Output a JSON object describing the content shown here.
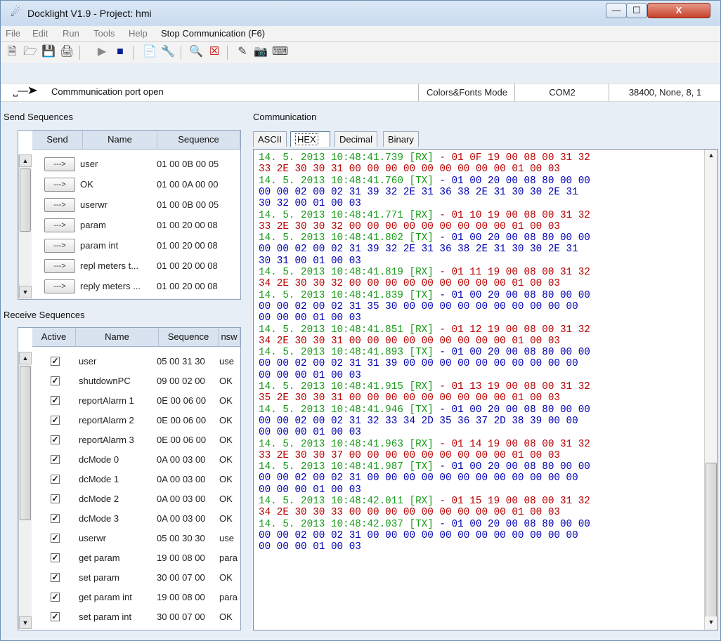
{
  "window": {
    "title": "Docklight V1.9 - Project: hmi",
    "app_icon": "docklight-app-icon",
    "buttons": {
      "minimize": "—",
      "maximize": "☐",
      "close": "X"
    }
  },
  "menu": [
    "File",
    "Edit",
    "Run",
    "Tools",
    "Help",
    "Stop Communication  (F6)"
  ],
  "toolbar": [
    "new-file-icon",
    "open-folder-icon",
    "save-icon",
    "print-icon",
    "play-icon",
    "stop-icon",
    "properties-icon",
    "wrench-icon",
    "binoculars-icon",
    "clear-icon",
    "edit-icon",
    "camera-icon",
    "keyboard-icon"
  ],
  "status": {
    "connection": "Commmunication port open",
    "colors_mode": "Colors&Fonts Mode",
    "port": "COM2",
    "settings": "38400, None, 8, 1"
  },
  "send": {
    "label": "Send Sequences",
    "headers": [
      "Send",
      "Name",
      "Sequence"
    ],
    "rows": [
      {
        "btn": "--->",
        "name": "user",
        "seq": "01 00 0B 00 05"
      },
      {
        "btn": "--->",
        "name": "OK",
        "seq": "01 00 0A 00 00"
      },
      {
        "btn": "--->",
        "name": "userwr",
        "seq": "01 00 0B 00 05"
      },
      {
        "btn": "--->",
        "name": "param",
        "seq": "01 00 20 00 08"
      },
      {
        "btn": "--->",
        "name": "param int",
        "seq": "01 00 20 00 08"
      },
      {
        "btn": "--->",
        "name": "repl meters t...",
        "seq": "01 00 20 00 08"
      },
      {
        "btn": "--->",
        "name": "reply meters ...",
        "seq": "01 00 20 00 08"
      }
    ]
  },
  "receive": {
    "label": "Receive Sequences",
    "headers": [
      "Active",
      "Name",
      "Sequence",
      "nsw"
    ],
    "rows": [
      {
        "name": "user",
        "seq": "05 00 31 30",
        "ans": "use"
      },
      {
        "name": "shutdownPC",
        "seq": "09 00 02 00",
        "ans": "OK"
      },
      {
        "name": "reportAlarm 1",
        "seq": "0E 00 06 00",
        "ans": "OK"
      },
      {
        "name": "reportAlarm 2",
        "seq": "0E 00 06 00",
        "ans": "OK"
      },
      {
        "name": "reportAlarm 3",
        "seq": "0E 00 06 00",
        "ans": "OK"
      },
      {
        "name": "dcMode 0",
        "seq": "0A 00 03 00",
        "ans": "OK"
      },
      {
        "name": "dcMode 1",
        "seq": "0A 00 03 00",
        "ans": "OK"
      },
      {
        "name": "dcMode 2",
        "seq": "0A 00 03 00",
        "ans": "OK"
      },
      {
        "name": "dcMode 3",
        "seq": "0A 00 03 00",
        "ans": "OK"
      },
      {
        "name": "userwr",
        "seq": "05 00 30 30",
        "ans": "use"
      },
      {
        "name": "get param",
        "seq": "19 00 08 00",
        "ans": "para"
      },
      {
        "name": "set param",
        "seq": "30 00 07 00",
        "ans": "OK"
      },
      {
        "name": "get param int",
        "seq": "19 00 08 00",
        "ans": "para"
      },
      {
        "name": "set param int",
        "seq": "30 00 07 00",
        "ans": "OK"
      }
    ],
    "check_mark": "✓"
  },
  "communication": {
    "label": "Communication",
    "tabs": [
      "ASCII",
      "HEX",
      "Decimal",
      "Binary"
    ],
    "active_tab": "HEX",
    "log": [
      {
        "dir": "RX",
        "ts": "14. 5. 2013 10:48:41.739 [RX]",
        "lines": [
          " - 01 0F 19 00 08 00 31 32",
          "33 2E 30 30 31 00 00 00 00 00 00 00 00 00 01 00 03"
        ]
      },
      {
        "dir": "TX",
        "ts": "14. 5. 2013 10:48:41.760 [TX]",
        "lines": [
          " - 01 00 20 00 08 80 00 00",
          "00 00 02 00 02 31 39 32 2E 31 36 38 2E 31 30 30 2E 31",
          "30 32 00 01 00 03"
        ]
      },
      {
        "dir": "RX",
        "ts": "14. 5. 2013 10:48:41.771 [RX]",
        "lines": [
          " - 01 10 19 00 08 00 31 32",
          "33 2E 30 30 32 00 00 00 00 00 00 00 00 00 01 00 03"
        ]
      },
      {
        "dir": "TX",
        "ts": "14. 5. 2013 10:48:41.802 [TX]",
        "lines": [
          " - 01 00 20 00 08 80 00 00",
          "00 00 02 00 02 31 39 32 2E 31 36 38 2E 31 30 30 2E 31",
          "30 31 00 01 00 03"
        ]
      },
      {
        "dir": "RX",
        "ts": "14. 5. 2013 10:48:41.819 [RX]",
        "lines": [
          " - 01 11 19 00 08 00 31 32",
          "34 2E 30 30 32 00 00 00 00 00 00 00 00 00 01 00 03"
        ]
      },
      {
        "dir": "TX",
        "ts": "14. 5. 2013 10:48:41.839 [TX]",
        "lines": [
          " - 01 00 20 00 08 80 00 00",
          "00 00 02 00 02 31 35 30 00 00 00 00 00 00 00 00 00 00",
          "00 00 00 01 00 03"
        ]
      },
      {
        "dir": "RX",
        "ts": "14. 5. 2013 10:48:41.851 [RX]",
        "lines": [
          " - 01 12 19 00 08 00 31 32",
          "34 2E 30 30 31 00 00 00 00 00 00 00 00 00 01 00 03"
        ]
      },
      {
        "dir": "TX",
        "ts": "14. 5. 2013 10:48:41.893 [TX]",
        "lines": [
          " - 01 00 20 00 08 80 00 00",
          "00 00 02 00 02 31 31 39 00 00 00 00 00 00 00 00 00 00",
          "00 00 00 01 00 03"
        ]
      },
      {
        "dir": "RX",
        "ts": "14. 5. 2013 10:48:41.915 [RX]",
        "lines": [
          " - 01 13 19 00 08 00 31 32",
          "35 2E 30 30 31 00 00 00 00 00 00 00 00 00 01 00 03"
        ]
      },
      {
        "dir": "TX",
        "ts": "14. 5. 2013 10:48:41.946 [TX]",
        "lines": [
          " - 01 00 20 00 08 80 00 00",
          "00 00 02 00 02 31 32 33 34 2D 35 36 37 2D 38 39 00 00",
          "00 00 00 01 00 03"
        ]
      },
      {
        "dir": "RX",
        "ts": "14. 5. 2013 10:48:41.963 [RX]",
        "lines": [
          " - 01 14 19 00 08 00 31 32",
          "33 2E 30 30 37 00 00 00 00 00 00 00 00 00 01 00 03"
        ]
      },
      {
        "dir": "TX",
        "ts": "14. 5. 2013 10:48:41.987 [TX]",
        "lines": [
          " - 01 00 20 00 08 80 00 00",
          "00 00 02 00 02 31 00 00 00 00 00 00 00 00 00 00 00 00",
          "00 00 00 01 00 03"
        ]
      },
      {
        "dir": "RX",
        "ts": "14. 5. 2013 10:48:42.011 [RX]",
        "lines": [
          " - 01 15 19 00 08 00 31 32",
          "34 2E 30 30 33 00 00 00 00 00 00 00 00 00 01 00 03"
        ]
      },
      {
        "dir": "TX",
        "ts": "14. 5. 2013 10:48:42.037 [TX]",
        "lines": [
          " - 01 00 20 00 08 80 00 00",
          "00 00 02 00 02 31 00 00 00 00 00 00 00 00 00 00 00 00",
          "00 00 00 01 00 03"
        ]
      }
    ]
  }
}
